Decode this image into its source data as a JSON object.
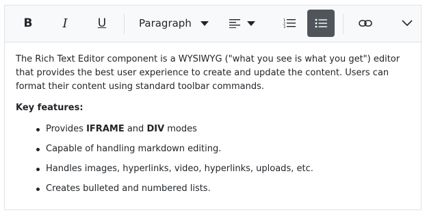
{
  "toolbar": {
    "bold_label": "B",
    "italic_label": "I",
    "underline_label": "U",
    "block_format": {
      "value": "Paragraph"
    }
  },
  "content": {
    "paragraph": "The Rich Text Editor component is a WYSIWYG (\"what you see is what you get\") editor that provides the best user experience to create and update the content. Users can format their content using standard toolbar commands.",
    "features_heading": "Key features:",
    "features": [
      {
        "pre": "Provides ",
        "b1": "IFRAME",
        "mid": " and ",
        "b2": "DIV",
        "post": " modes"
      },
      {
        "text": "Capable of handling markdown editing."
      },
      {
        "text": "Handles images, hyperlinks, video, hyperlinks, uploads, etc."
      },
      {
        "text": "Creates bulleted and numbered lists."
      }
    ]
  },
  "colors": {
    "toolbar_bg": "#f8f9fa",
    "active_btn_bg": "#4f555a",
    "border": "#dee2e6",
    "text": "#212529"
  }
}
